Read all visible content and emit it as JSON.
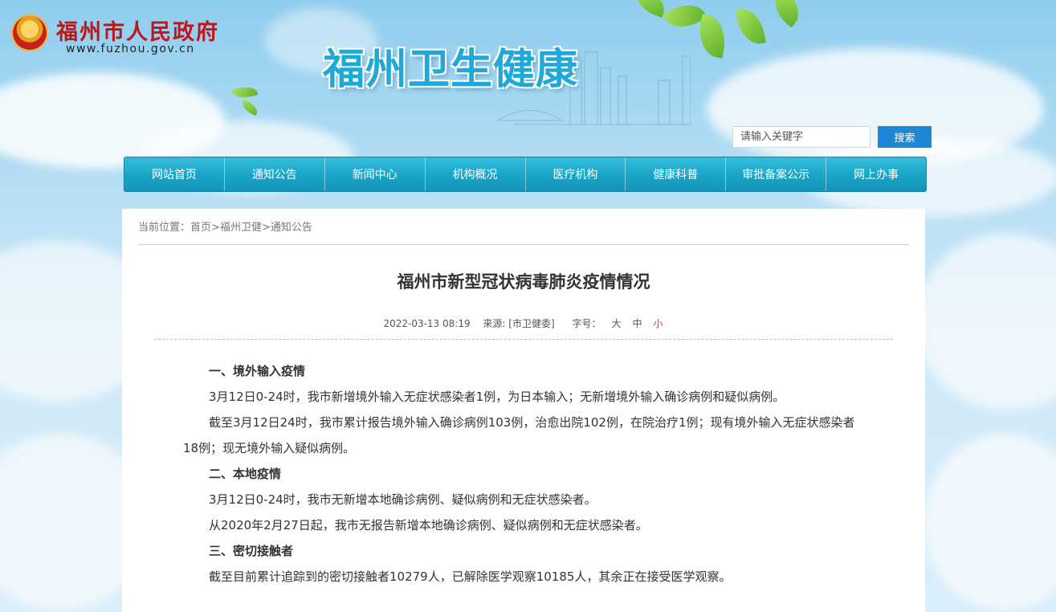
{
  "header": {
    "gov_name": "福州市人民政府",
    "gov_url": "www.fuzhou.gov.cn",
    "site_title": "福州卫生健康"
  },
  "search": {
    "placeholder": "请输入关键字",
    "button": "搜索"
  },
  "nav": [
    "网站首页",
    "通知公告",
    "新闻中心",
    "机构概况",
    "医疗机构",
    "健康科普",
    "审批备案公示",
    "网上办事"
  ],
  "breadcrumb": {
    "prefix": "当前位置：",
    "items": [
      "首页",
      "福州卫健",
      "通知公告"
    ],
    "separator": ">"
  },
  "article": {
    "title": "福州市新型冠状病毒肺炎疫情情况",
    "date": "2022-03-13 08:19",
    "source": "来源: [市卫健委]",
    "font_size_label": "字号：",
    "font_sizes": [
      "大",
      "中",
      "小"
    ],
    "active_font_size": "小",
    "paragraphs": [
      {
        "type": "heading",
        "text": "一、境外输入疫情"
      },
      {
        "type": "text",
        "text": "3月12日0-24时，我市新增境外输入无症状感染者1例，为日本输入；无新增境外输入确诊病例和疑似病例。"
      },
      {
        "type": "text",
        "text": "截至3月12日24时，我市累计报告境外输入确诊病例103例，治愈出院102例，在院治疗1例；现有境外输入无症状感染者18例；现无境外输入疑似病例。"
      },
      {
        "type": "heading",
        "text": "二、本地疫情"
      },
      {
        "type": "text",
        "text": "3月12日0-24时，我市无新增本地确诊病例、疑似病例和无症状感染者。"
      },
      {
        "type": "text",
        "text": "从2020年2月27日起，我市无报告新增本地确诊病例、疑似病例和无症状感染者。"
      },
      {
        "type": "heading",
        "text": "三、密切接触者"
      },
      {
        "type": "text",
        "text": "截至目前累计追踪到的密切接触者10279人，已解除医学观察10185人，其余正在接受医学观察。"
      }
    ]
  },
  "colors": {
    "gov_red": "#c0151b",
    "site_title_blue": "#1fa9d8",
    "nav_teal": "#19a4c7",
    "search_blue": "#1e88d6",
    "active_font_size": "#d0451b"
  }
}
